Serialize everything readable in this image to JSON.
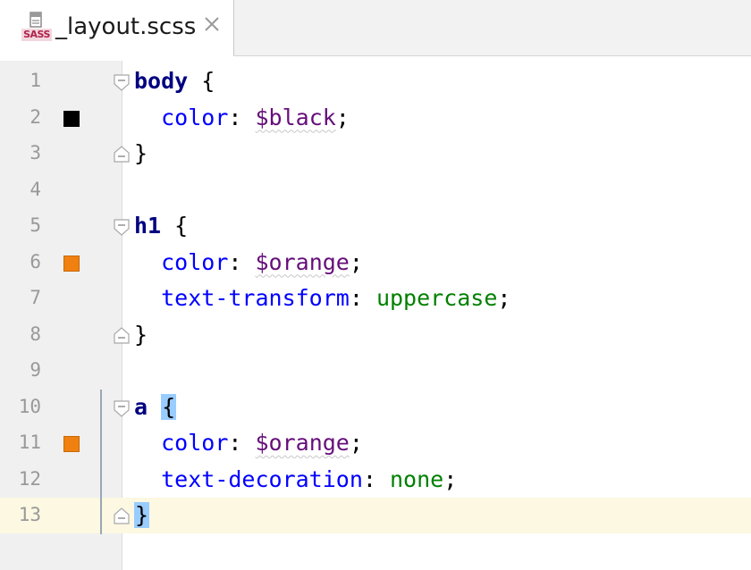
{
  "tab": {
    "icon_label": "SASS",
    "title": "_layout.scss"
  },
  "editor": {
    "caret_line": 13,
    "lines": [
      {
        "num": "1",
        "swatch": null,
        "fold": "open",
        "tokens": [
          {
            "t": "body",
            "c": "selector"
          },
          {
            "t": " ",
            "c": "punct"
          },
          {
            "t": "{",
            "c": "brace"
          }
        ]
      },
      {
        "num": "2",
        "swatch": "#000000",
        "fold": null,
        "tokens": [
          {
            "t": "  ",
            "c": "punct"
          },
          {
            "t": "color",
            "c": "prop"
          },
          {
            "t": ": ",
            "c": "punct"
          },
          {
            "t": "$black",
            "c": "var"
          },
          {
            "t": ";",
            "c": "punct"
          }
        ]
      },
      {
        "num": "3",
        "swatch": null,
        "fold": "close",
        "tokens": [
          {
            "t": "}",
            "c": "brace"
          }
        ]
      },
      {
        "num": "4",
        "swatch": null,
        "fold": null,
        "tokens": []
      },
      {
        "num": "5",
        "swatch": null,
        "fold": "open",
        "tokens": [
          {
            "t": "h1",
            "c": "selector"
          },
          {
            "t": " ",
            "c": "punct"
          },
          {
            "t": "{",
            "c": "brace"
          }
        ]
      },
      {
        "num": "6",
        "swatch": "#f08010",
        "fold": null,
        "tokens": [
          {
            "t": "  ",
            "c": "punct"
          },
          {
            "t": "color",
            "c": "prop"
          },
          {
            "t": ": ",
            "c": "punct"
          },
          {
            "t": "$orange",
            "c": "var"
          },
          {
            "t": ";",
            "c": "punct"
          }
        ]
      },
      {
        "num": "7",
        "swatch": null,
        "fold": null,
        "tokens": [
          {
            "t": "  ",
            "c": "punct"
          },
          {
            "t": "text-transform",
            "c": "prop"
          },
          {
            "t": ": ",
            "c": "punct"
          },
          {
            "t": "uppercase",
            "c": "kw"
          },
          {
            "t": ";",
            "c": "punct"
          }
        ]
      },
      {
        "num": "8",
        "swatch": null,
        "fold": "close",
        "tokens": [
          {
            "t": "}",
            "c": "brace"
          }
        ]
      },
      {
        "num": "9",
        "swatch": null,
        "fold": null,
        "tokens": []
      },
      {
        "num": "10",
        "swatch": null,
        "fold": "open",
        "tokens": [
          {
            "t": "a",
            "c": "selector"
          },
          {
            "t": " ",
            "c": "punct"
          },
          {
            "t": "{",
            "c": "brace-match"
          }
        ]
      },
      {
        "num": "11",
        "swatch": "#f08010",
        "fold": null,
        "tokens": [
          {
            "t": "  ",
            "c": "punct"
          },
          {
            "t": "color",
            "c": "prop"
          },
          {
            "t": ": ",
            "c": "punct"
          },
          {
            "t": "$orange",
            "c": "var"
          },
          {
            "t": ";",
            "c": "punct"
          }
        ]
      },
      {
        "num": "12",
        "swatch": null,
        "fold": null,
        "tokens": [
          {
            "t": "  ",
            "c": "punct"
          },
          {
            "t": "text-decoration",
            "c": "prop"
          },
          {
            "t": ": ",
            "c": "punct"
          },
          {
            "t": "none",
            "c": "kw"
          },
          {
            "t": ";",
            "c": "punct"
          }
        ]
      },
      {
        "num": "13",
        "swatch": null,
        "fold": "close",
        "tokens": [
          {
            "t": "}",
            "c": "brace-match"
          }
        ]
      }
    ]
  }
}
